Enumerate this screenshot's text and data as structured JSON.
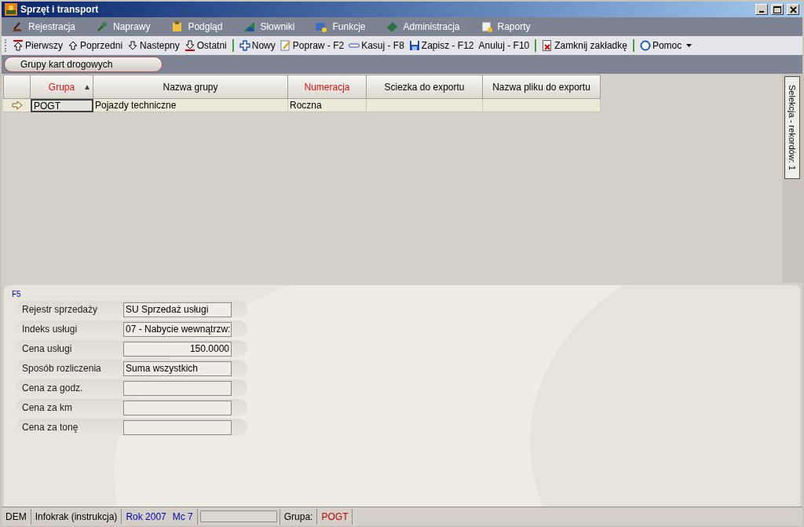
{
  "window": {
    "title": "Sprzęt i transport"
  },
  "menu": [
    {
      "label": "Rejestracja"
    },
    {
      "label": "Naprawy"
    },
    {
      "label": "Podgląd"
    },
    {
      "label": "Słowniki"
    },
    {
      "label": "Funkcje"
    },
    {
      "label": "Administracja"
    },
    {
      "label": "Raporty"
    }
  ],
  "toolbar": {
    "groups": [
      [
        {
          "label": "Pierwszy"
        },
        {
          "label": "Poprzedni"
        },
        {
          "label": "Nastepny"
        },
        {
          "label": "Ostatni"
        }
      ],
      [
        {
          "label": "Nowy"
        },
        {
          "label": "Popraw - F2"
        },
        {
          "label": "Kasuj - F8"
        },
        {
          "label": "Zapisz - F12"
        },
        {
          "label": "Anuluj - F10"
        }
      ],
      [
        {
          "label": "Zamknij zakładkę"
        }
      ],
      [
        {
          "label": "Pomoc",
          "dropdown": true
        }
      ]
    ]
  },
  "tabs": [
    {
      "label": "Grupy kart drogowych",
      "selected": true
    }
  ],
  "table": {
    "columns": [
      {
        "label": "Grupa",
        "required": true,
        "sorted": true
      },
      {
        "label": "Nazwa grupy",
        "required": false,
        "sorted": false
      },
      {
        "label": "Numeracja",
        "required": true,
        "sorted": false
      },
      {
        "label": "Sciezka do exportu",
        "required": false,
        "sorted": false
      },
      {
        "label": "Nazwa pliku do exportu",
        "required": false,
        "sorted": false
      }
    ],
    "rows": [
      {
        "selected": true,
        "cells": [
          "POGT",
          "Pojazdy techniczne",
          "Roczna",
          "",
          ""
        ]
      }
    ]
  },
  "side_tab": {
    "label": "Selekcja - rekordów: 1"
  },
  "form": {
    "shortcut": "F5",
    "fields": [
      {
        "label": "Rejestr sprzedaży",
        "value": "SU Sprzedaż usługi",
        "kind": "text"
      },
      {
        "label": "Indeks usługi",
        "value": "07 - Nabycie wewnątrzw:",
        "kind": "text"
      },
      {
        "label": "Cena usługi",
        "value": "150.0000",
        "kind": "number"
      },
      {
        "label": "Sposób rozliczenia",
        "value": "Suma wszystkich",
        "kind": "text"
      },
      {
        "label": "Cena za godz.",
        "kind": "number"
      },
      {
        "label": "Cena za km",
        "kind": "number"
      },
      {
        "label": "Cena za tonę",
        "kind": "number"
      }
    ]
  },
  "status_bar": [
    {
      "kind": "text",
      "text": "DEM",
      "color": "#000000"
    },
    {
      "kind": "text",
      "text": "Infokrak (instrukcja)",
      "color": "#000000"
    },
    {
      "kind": "pair",
      "parts": [
        "Rok 2007",
        "Mc 7"
      ],
      "color": "#0000c0"
    },
    {
      "kind": "box"
    },
    {
      "kind": "text",
      "text": "Grupa:",
      "color": "#000000"
    },
    {
      "kind": "text",
      "text": "POGT",
      "color": "#c00000"
    }
  ]
}
